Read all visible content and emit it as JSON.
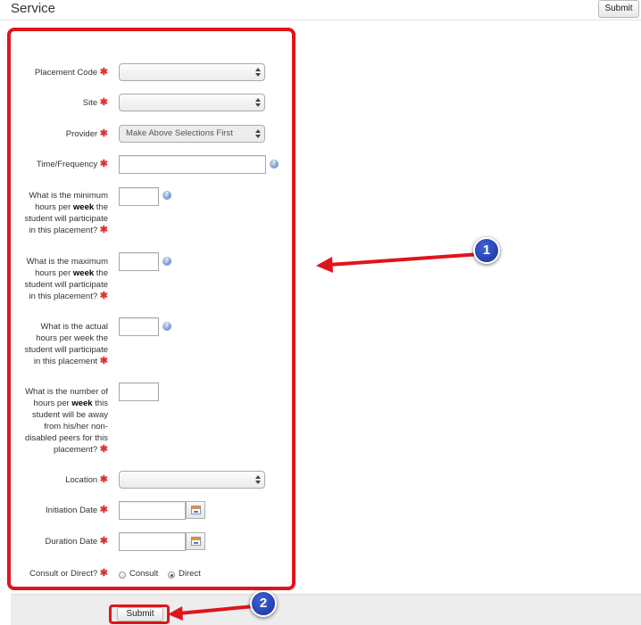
{
  "header": {
    "title": "Service",
    "submit_label": "Submit"
  },
  "form": {
    "required_mark": "✱",
    "placement_code": {
      "label": "Placement Code",
      "value": ""
    },
    "site": {
      "label": "Site",
      "value": ""
    },
    "provider": {
      "label": "Provider",
      "value": "Make Above Selections First"
    },
    "time_frequency": {
      "label": "Time/Frequency",
      "value": ""
    },
    "min_hours": {
      "label_line1": "What is the minimum",
      "label_line2_pre": "hours per ",
      "label_line2_bold": "week",
      "label_line2_post": " the",
      "label_line3": "student will participate",
      "label_line4": "in this placement?",
      "value": ""
    },
    "max_hours": {
      "label_line1": "What is the maximum",
      "label_line2_pre": "hours per ",
      "label_line2_bold": "week",
      "label_line2_post": " the",
      "label_line3": "student will participate",
      "label_line4": "in this placement?",
      "value": ""
    },
    "actual_hours": {
      "label_line1": "What is the actual",
      "label_line2": "hours per week the",
      "label_line3": "student will participate",
      "label_line4": "in this placement",
      "value": ""
    },
    "away_hours": {
      "label_line1": "What is the number of",
      "label_line2_pre": "hours per ",
      "label_line2_bold": "week",
      "label_line2_post": " this",
      "label_line3": "student will be away",
      "label_line4": "from his/her non-",
      "label_line5": "disabled peers for this",
      "label_line6": "placement?",
      "value": ""
    },
    "location": {
      "label": "Location",
      "value": ""
    },
    "initiation_date": {
      "label": "Initiation Date",
      "value": ""
    },
    "duration_date": {
      "label": "Duration Date",
      "value": ""
    },
    "consult_or_direct": {
      "label": "Consult or Direct?",
      "options": [
        "Consult",
        "Direct"
      ],
      "selected": "Direct"
    }
  },
  "footer": {
    "submit_label": "Submit"
  },
  "annotations": {
    "callout1": "1",
    "callout2": "2",
    "color": "#e0141b"
  }
}
